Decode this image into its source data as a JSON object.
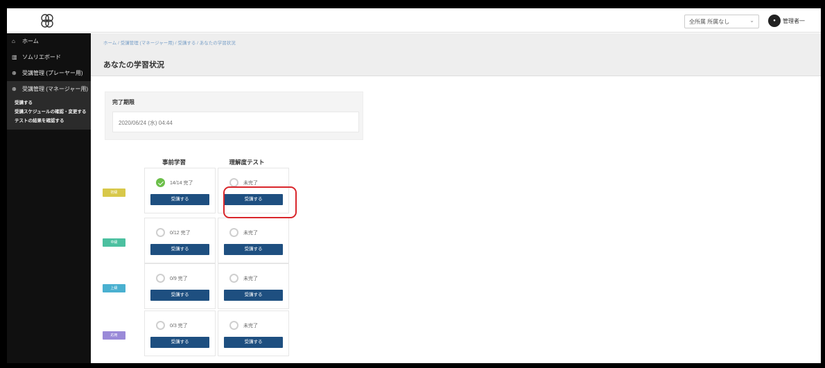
{
  "header": {
    "user_select_value": "全所属  所属なし",
    "user_name": "管理者一"
  },
  "sidebar": {
    "items": [
      {
        "label": "ホーム",
        "icon": "home-icon"
      },
      {
        "label": "ソムリエボード",
        "icon": "chart-icon"
      },
      {
        "label": "受講管理 (プレーヤー用)",
        "icon": "plus-circle-icon"
      },
      {
        "label": "受講管理 (マネージャー用)",
        "icon": "plus-circle-icon"
      }
    ],
    "sub_items": [
      "受講する",
      "受講スケジュールの確認・変更する",
      "テストの結果を確認する"
    ]
  },
  "breadcrumb": "ホーム / 受講管理 (マネージャー用) / 受講する / あなたの学習状況",
  "page_title": "あなたの学習状況",
  "completion_card": {
    "label": "完了期限",
    "value": "2020/06/24 (水) 04:44"
  },
  "columns": {
    "pre_learning": "事前学習",
    "understanding_test": "理解度テスト"
  },
  "rows": [
    {
      "tag": "初級",
      "tag_color": "#d8c84a",
      "pre_status": "14/14 完了",
      "pre_done": true,
      "test_status": "未完了",
      "test_done": false,
      "pre_button": "受講する",
      "test_button": "受講する"
    },
    {
      "tag": "中級",
      "tag_color": "#4cc0a0",
      "pre_status": "0/12 完了",
      "pre_done": false,
      "test_status": "未完了",
      "test_done": false,
      "pre_button": "受講する",
      "test_button": "受講する"
    },
    {
      "tag": "上級",
      "tag_color": "#4ab0d0",
      "pre_status": "0/9 完了",
      "pre_done": false,
      "test_status": "未完了",
      "test_done": false,
      "pre_button": "受講する",
      "test_button": "受講する"
    },
    {
      "tag": "応用",
      "tag_color": "#9a8ad8",
      "pre_status": "0/3 完了",
      "pre_done": false,
      "test_status": "未完了",
      "test_done": false,
      "pre_button": "受講する",
      "test_button": "受講する"
    }
  ]
}
